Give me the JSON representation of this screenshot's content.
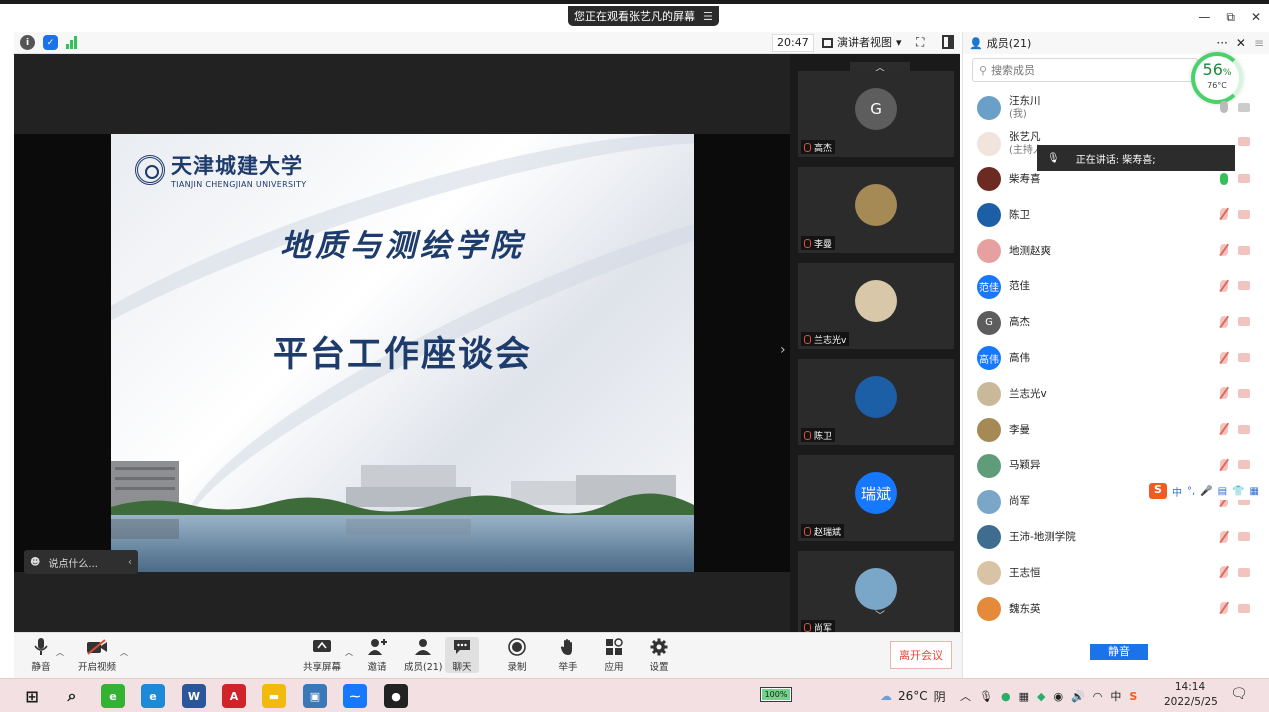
{
  "window": {
    "share_banner": "您正在观看张艺凡的屏幕",
    "minimize": "—",
    "restore": "⧉",
    "close": "✕"
  },
  "topbar": {
    "clock": "20:47",
    "view_label": "演讲者视图",
    "view_caret": "▾"
  },
  "slide": {
    "university_cn": "天津城建大学",
    "university_en": "TIANJIN CHENGJIAN UNIVERSITY",
    "title_line1": "地质与测绘学院",
    "title_line2": "平台工作座谈会"
  },
  "chat_pill": {
    "placeholder": "说点什么..."
  },
  "gallery": {
    "up_arrow": "︿",
    "down_arrow": "﹀",
    "toggle": "›",
    "tiles": [
      {
        "name": "高杰",
        "avatar_text": "G",
        "color": "#5d5d5d"
      },
      {
        "name": "李曼",
        "avatar_text": "",
        "color": "#a58a56"
      },
      {
        "name": "兰志光v",
        "avatar_text": "",
        "color": "#d8c7a8"
      },
      {
        "name": "陈卫",
        "avatar_text": "",
        "color": "#1c5fa6"
      },
      {
        "name": "赵瑞斌",
        "avatar_text": "瑞斌",
        "color": "#1677ff"
      },
      {
        "name": "尚军",
        "avatar_text": "",
        "color": "#7aa7c8"
      }
    ]
  },
  "toolbar": {
    "mute": "静音",
    "video": "开启视频",
    "share": "共享屏幕",
    "invite": "邀请",
    "members": "成员(21)",
    "chat": "聊天",
    "record": "录制",
    "raise_hand": "举手",
    "apps": "应用",
    "settings": "设置",
    "leave": "离开会议"
  },
  "members_panel": {
    "title": "成员(21)",
    "more": "···",
    "close": "✕",
    "search_placeholder": "搜索成员",
    "gauge_percent": "56",
    "gauge_percent_unit": "%",
    "gauge_temp": "76°C",
    "speaking_tip": "正在讲话: 柴寿喜;",
    "mute_all": "静音",
    "members": [
      {
        "name": "汪东川",
        "sub": "(我)",
        "avatar_text": "",
        "color": "#6aa0c8",
        "mic": "grey",
        "cam": "grey"
      },
      {
        "name": "张艺凡",
        "sub": "(主持人)",
        "avatar_text": "",
        "color": "#f0e4dc",
        "mic": "hidden",
        "cam": "off"
      },
      {
        "name": "柴寿喜",
        "sub": "",
        "avatar_text": "",
        "color": "#6b2a22",
        "mic": "on",
        "cam": "off"
      },
      {
        "name": "陈卫",
        "sub": "",
        "avatar_text": "",
        "color": "#1c5fa6",
        "mic": "off",
        "cam": "off"
      },
      {
        "name": "地测赵爽",
        "sub": "",
        "avatar_text": "",
        "color": "#e7a0a0",
        "mic": "off",
        "cam": "off"
      },
      {
        "name": "范佳",
        "sub": "",
        "avatar_text": "范佳",
        "color": "#1677ff",
        "mic": "off",
        "cam": "off"
      },
      {
        "name": "高杰",
        "sub": "",
        "avatar_text": "G",
        "color": "#5d5d5d",
        "mic": "off",
        "cam": "off"
      },
      {
        "name": "高伟",
        "sub": "",
        "avatar_text": "高伟",
        "color": "#1677ff",
        "mic": "off",
        "cam": "off"
      },
      {
        "name": "兰志光v",
        "sub": "",
        "avatar_text": "",
        "color": "#c9b89a",
        "mic": "off",
        "cam": "off"
      },
      {
        "name": "李曼",
        "sub": "",
        "avatar_text": "",
        "color": "#a58a56",
        "mic": "off",
        "cam": "off"
      },
      {
        "name": "马颖异",
        "sub": "",
        "avatar_text": "",
        "color": "#5f9c7a",
        "mic": "off",
        "cam": "off"
      },
      {
        "name": "尚军",
        "sub": "",
        "avatar_text": "",
        "color": "#7aa7c8",
        "mic": "off",
        "cam": "off"
      },
      {
        "name": "王沛-地测学院",
        "sub": "",
        "avatar_text": "",
        "color": "#3f6d8f",
        "mic": "off",
        "cam": "off"
      },
      {
        "name": "王志恒",
        "sub": "",
        "avatar_text": "",
        "color": "#d9c3a5",
        "mic": "off",
        "cam": "off"
      },
      {
        "name": "魏东英",
        "sub": "",
        "avatar_text": "",
        "color": "#e58a3a",
        "mic": "off",
        "cam": "off"
      }
    ],
    "ime": {
      "logo": "S",
      "items": [
        "中",
        "°,",
        "🎤",
        "▤",
        "👕",
        "▦"
      ]
    }
  },
  "taskbar": {
    "apps": [
      {
        "name": "start",
        "glyph": "⊞",
        "color": "#1b1b1b"
      },
      {
        "name": "search",
        "glyph": "⌕",
        "color": "#1b1b1b"
      },
      {
        "name": "ie",
        "glyph": "e",
        "color": "#34b233"
      },
      {
        "name": "edge",
        "glyph": "e",
        "color": "#1c8ad6"
      },
      {
        "name": "word",
        "glyph": "W",
        "color": "#2b579a"
      },
      {
        "name": "acrobat",
        "glyph": "A",
        "color": "#d1232a"
      },
      {
        "name": "explorer",
        "glyph": "▬",
        "color": "#f2b90e"
      },
      {
        "name": "photos",
        "glyph": "▣",
        "color": "#3a78b8"
      },
      {
        "name": "meeting",
        "glyph": "⁓",
        "color": "#1677ff"
      },
      {
        "name": "recorder",
        "glyph": "●",
        "color": "#222"
      }
    ],
    "battery": "100%",
    "weather_temp": "26°C",
    "weather_text": "阴",
    "time": "14:14",
    "date": "2022/5/25",
    "ime_lang": "中"
  },
  "colors": {
    "accent_blue": "#1677ff",
    "leave_red": "#e04a3a",
    "speaking_green": "#35c05a"
  }
}
